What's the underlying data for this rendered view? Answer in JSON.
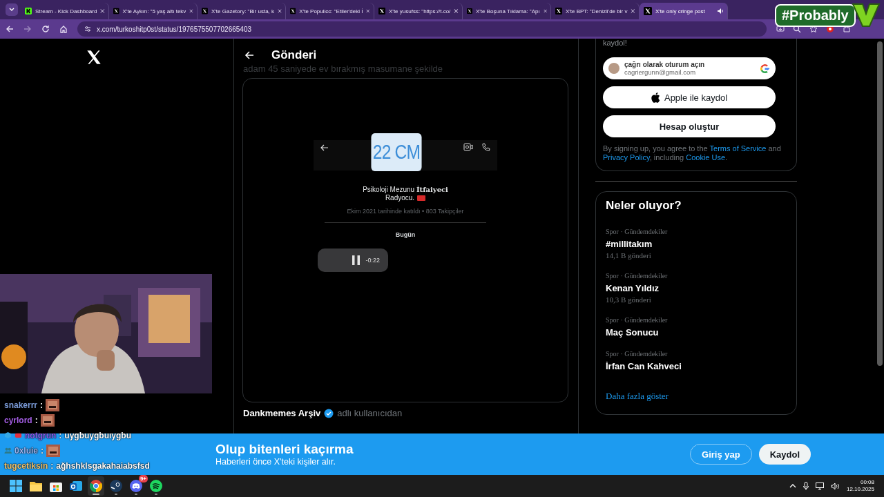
{
  "browser": {
    "tabs": [
      {
        "kind": "kick",
        "label": "Stream - Kick Dashboard",
        "selected": false
      },
      {
        "kind": "x",
        "label": "X'te Aykırı: \"5 yaş altı tekv",
        "selected": false
      },
      {
        "kind": "x",
        "label": "X'te Gazetory: \"Bir usta, k",
        "selected": false
      },
      {
        "kind": "x",
        "label": "X'te Populicc: \"Etiler'deki İ",
        "selected": false
      },
      {
        "kind": "x",
        "label": "X'te yusufss: \"https://t.co/",
        "selected": false
      },
      {
        "kind": "x",
        "label": "X'te Boşuna Tıklama: \"Apı",
        "selected": false
      },
      {
        "kind": "x",
        "label": "X'te BPT: \"Denizli'de bir v",
        "selected": false
      },
      {
        "kind": "x",
        "label": "X'te only cringe post",
        "selected": true
      }
    ],
    "url": "x.com/turkoshitp0st/status/1976575507702665403"
  },
  "stream_badge": {
    "text": "#Probably"
  },
  "post": {
    "header": "Gönderi",
    "caption": "adam 45 saniyede ev bırakmış masumane şekilde",
    "video": {
      "name_badge": "22 CM",
      "bio": [
        "Psikoloji Mezunu **İtfaiyeci**",
        "Radyocu."
      ],
      "joined": "Ekim 2021 tarihinde katıldı • 803 Takipçiler",
      "day": "Bugün",
      "voice_time": "-0:22"
    },
    "source": {
      "name": "Dankmemes Arşiv",
      "verified": true,
      "suffix": "adlı kullanıcıdan"
    }
  },
  "signup": {
    "partial": "kaydol!",
    "google": {
      "title": "çağrı olarak oturum açın",
      "email": "cagriergunn@gmail.com"
    },
    "apple": "Apple ile kaydol",
    "create": "Hesap oluştur",
    "legal": [
      {
        "text": "By signing up, you agree to the ",
        "link": false
      },
      {
        "text": "Terms of Service",
        "link": true
      },
      {
        "text": " and ",
        "link": false
      },
      {
        "text": "Privacy Policy",
        "link": true
      },
      {
        "text": ", including ",
        "link": false
      },
      {
        "text": "Cookie Use",
        "link": true
      },
      {
        "text": ".",
        "link": false
      }
    ]
  },
  "trends": {
    "title": "Neler oluyor?",
    "items": [
      {
        "context": "Spor · Gündemdekiler",
        "name": "#millitakım",
        "count": "14,1 B gönderi"
      },
      {
        "context": "Spor · Gündemdekiler",
        "name": "Kenan Yıldız",
        "count": "10,3 B gönderi"
      },
      {
        "context": "Spor · Gündemdekiler",
        "name": "Maç Sonucu"
      },
      {
        "context": "Spor · Gündemdekiler",
        "name": "İrfan Can Kahveci"
      }
    ],
    "more": "Daha fazla göster"
  },
  "banner": {
    "title": "Olup bitenleri kaçırma",
    "subtitle": "Haberleri önce X'teki kişiler alır.",
    "login": "Giriş yap",
    "signup": "Kaydol"
  },
  "chat": [
    {
      "user": "snakerrr",
      "color": "#7b9bd8",
      "separator": ":",
      "kind": "emote"
    },
    {
      "user": "cyrlord",
      "color": "#a55ee6",
      "separator": ":",
      "kind": "emote"
    },
    {
      "user": "notgrun",
      "color": "#8e5cf0",
      "separator": ":",
      "kind": "text",
      "message": "uygbuygbuıygbu",
      "badges": [
        {
          "kind": "cube"
        },
        {
          "kind": "camera"
        }
      ]
    },
    {
      "user": "0xluie",
      "color": "#9bb4f2",
      "separator": ":",
      "kind": "emote",
      "badges": [
        {
          "kind": "people"
        }
      ]
    },
    {
      "user": "tugcetiksin",
      "color": "#f2c46e",
      "separator": ":",
      "kind": "text",
      "message": "ağhshklsgakahaiabsfsd"
    }
  ],
  "taskbar": {
    "apps": [
      {
        "kind": "windows",
        "selected": false,
        "running": false
      },
      {
        "kind": "folder",
        "selected": false,
        "running": false
      },
      {
        "kind": "store",
        "selected": false,
        "running": false
      },
      {
        "kind": "outlook",
        "selected": false,
        "running": false
      },
      {
        "kind": "chrome",
        "selected": true,
        "running": true
      },
      {
        "kind": "steam",
        "selected": false,
        "running": true
      },
      {
        "kind": "discord",
        "selected": false,
        "running": true,
        "badge": "9+"
      },
      {
        "kind": "spotify",
        "selected": false,
        "running": true
      }
    ],
    "time": "00:08",
    "date": "12.10.2025"
  }
}
